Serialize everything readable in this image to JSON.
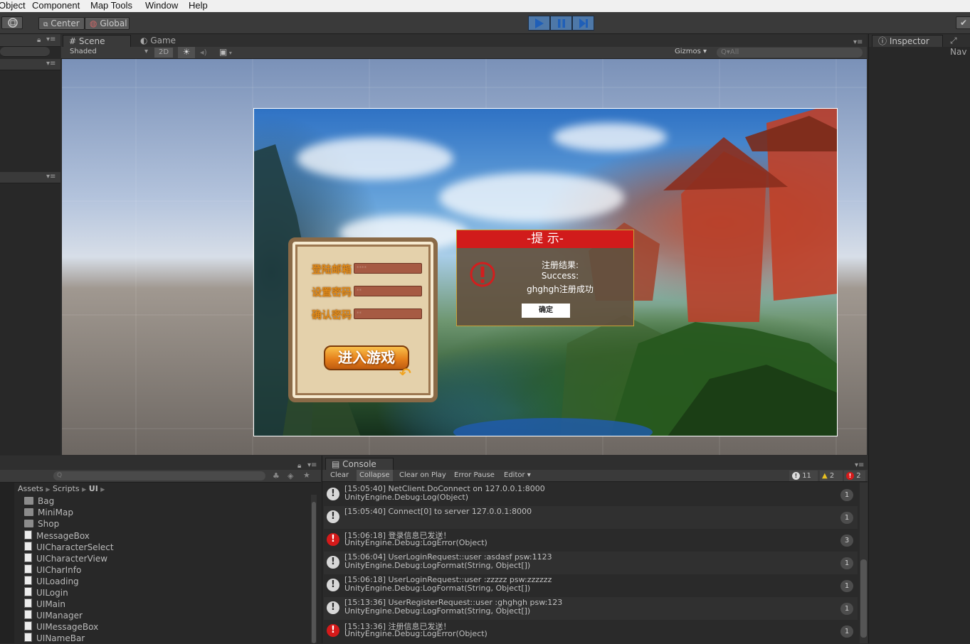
{
  "menu": {
    "items": [
      "Object",
      "Component",
      "Map Tools",
      "Window",
      "Help"
    ]
  },
  "toolbar": {
    "pivot_label": "Center",
    "space_label": "Global"
  },
  "scene_panel": {
    "tab_scene": "Scene",
    "tab_game": "Game",
    "shading_mode": "Shaded",
    "mode_2d": "2D",
    "gizmos_label": "Gizmos",
    "search_placeholder": "All"
  },
  "inspector": {
    "tab_inspector": "Inspector",
    "tab_nav": "Nav"
  },
  "game": {
    "login": {
      "email_label": "登陆邮箱",
      "password_label": "设置密码",
      "confirm_label": "确认密码",
      "email_value": "****",
      "password_value": "**",
      "confirm_value": "**",
      "enter_button": "进入游戏"
    },
    "dialog": {
      "title": "-提 示-",
      "line1": "注册结果:",
      "line2": "Success:",
      "line3": "ghghgh注册成功",
      "ok_button": "确定"
    }
  },
  "project": {
    "breadcrumb": [
      "Assets",
      "Scripts",
      "UI"
    ],
    "items": [
      {
        "name": "Bag",
        "type": "folder"
      },
      {
        "name": "MiniMap",
        "type": "folder"
      },
      {
        "name": "Shop",
        "type": "folder"
      },
      {
        "name": "MessageBox",
        "type": "script"
      },
      {
        "name": "UICharacterSelect",
        "type": "script"
      },
      {
        "name": "UICharacterView",
        "type": "script"
      },
      {
        "name": "UICharInfo",
        "type": "script"
      },
      {
        "name": "UILoading",
        "type": "script"
      },
      {
        "name": "UILogin",
        "type": "script"
      },
      {
        "name": "UIMain",
        "type": "script"
      },
      {
        "name": "UIManager",
        "type": "script"
      },
      {
        "name": "UIMessageBox",
        "type": "script"
      },
      {
        "name": "UINameBar",
        "type": "script"
      }
    ]
  },
  "console": {
    "tab": "Console",
    "buttons": [
      "Clear",
      "Collapse",
      "Clear on Play",
      "Error Pause",
      "Editor"
    ],
    "counts": {
      "log": "11",
      "warn": "2",
      "error": "2"
    },
    "entries": [
      {
        "level": "log",
        "line1": "[15:05:40] NetClient.DoConnect on 127.0.0.1:8000",
        "line2": "UnityEngine.Debug:Log(Object)",
        "count": "1"
      },
      {
        "level": "log",
        "line1": "[15:05:40] Connect[0] to server 127.0.0.1:8000",
        "line2": "",
        "count": "1"
      },
      {
        "level": "error",
        "line1": "[15:06:18] 登录信息已发送！",
        "line2": "UnityEngine.Debug:LogError(Object)",
        "count": "3"
      },
      {
        "level": "log",
        "line1": "[15:06:04] UserLoginRequest::user :asdasf psw:1123",
        "line2": "UnityEngine.Debug:LogFormat(String, Object[])",
        "count": "1"
      },
      {
        "level": "log",
        "line1": "[15:06:18] UserLoginRequest::user :zzzzz psw:zzzzzz",
        "line2": "UnityEngine.Debug:LogFormat(String, Object[])",
        "count": "1"
      },
      {
        "level": "log",
        "line1": "[15:13:36] UserRegisterRequest::user :ghghgh psw:123",
        "line2": "UnityEngine.Debug:LogFormat(String, Object[])",
        "count": "1"
      },
      {
        "level": "error",
        "line1": "[15:13:36] 注册信息已发送！",
        "line2": "UnityEngine.Debug:LogError(Object)",
        "count": "1"
      }
    ]
  }
}
